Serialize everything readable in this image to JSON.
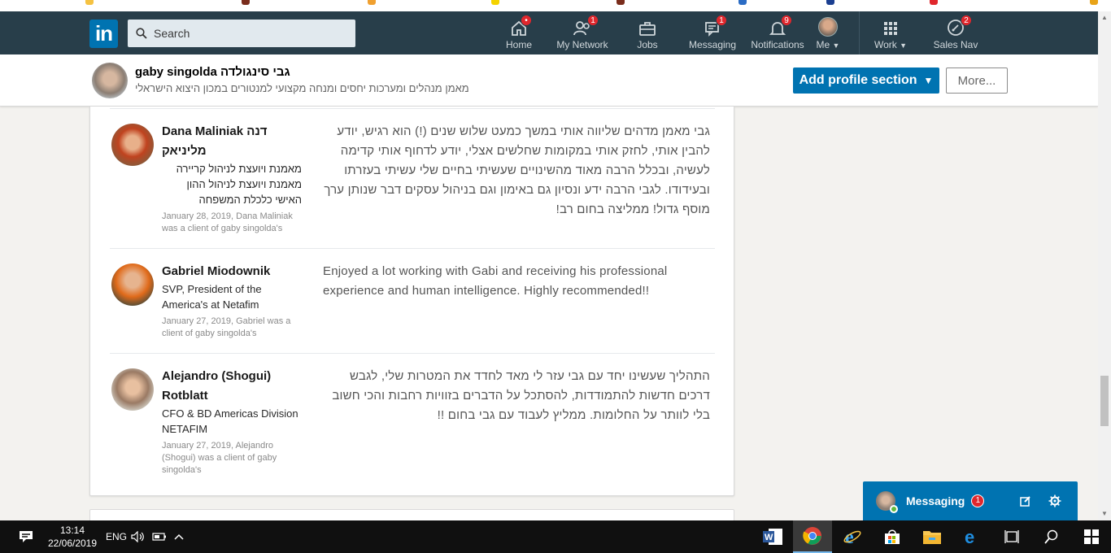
{
  "nav": {
    "search_placeholder": "Search",
    "items": [
      {
        "label": "Home",
        "badge": "•"
      },
      {
        "label": "My Network",
        "badge": "1"
      },
      {
        "label": "Jobs",
        "badge": ""
      },
      {
        "label": "Messaging",
        "badge": "1"
      },
      {
        "label": "Notifications",
        "badge": "9"
      },
      {
        "label": "Me",
        "badge": ""
      },
      {
        "label": "Work",
        "badge": ""
      },
      {
        "label": "Sales Nav",
        "badge": "2"
      }
    ]
  },
  "profile": {
    "name": "gaby singolda גבי סינגולדה",
    "headline": "מאמן מנהלים ומערכות יחסים ומנחה מקצועי למנטורים במכון היצוא הישראלי",
    "add_section_label": "Add profile section",
    "more_label": "More..."
  },
  "recommendations": [
    {
      "name": "Dana Maliniak דנה מליניאק",
      "title": "מאמנת ויועצת לניהול קריירה מאמנת ויועצת לניהול ההון האישי כלכלת המשפחה",
      "meta": "January 28, 2019, Dana Maliniak was a client of gaby singolda's",
      "text": "גבי מאמן מדהים שליווה אותי במשך כמעט שלוש שנים (!) הוא רגיש, יודע להבין אותי, לחזק אותי במקומות שחלשים אצלי, יודע לדחוף אותי קדימה לעשיה, ובכלל הרבה מאוד מהשינויים שעשיתי בחיים שלי עשיתי בעזרתו ובעידודו. לגבי הרבה ידע ונסיון גם באימון וגם בניהול עסקים דבר שנותן ערך מוסף גדול! ממליצה בחום רב!"
    },
    {
      "name": "Gabriel Miodownik",
      "title": "SVP, President of the America's at Netafim",
      "meta": "January 27, 2019, Gabriel was a client of gaby singolda's",
      "text": "Enjoyed a lot working with Gabi and receiving his professional experience and human intelligence. Highly recommended!!"
    },
    {
      "name": "Alejandro (Shogui) Rotblatt",
      "title": "CFO & BD Americas Division NETAFIM",
      "meta": "January 27, 2019, Alejandro (Shogui) was a client of gaby singolda's",
      "text": "התהליך שעשינו יחד עם גבי עזר לי מאד לחדד את המטרות שלי, לגבש דרכים חדשות להתמודדות, להסתכל על הדברים בזוויות רחבות והכי חשוב בלי לוותר על החלומות. ממליץ לעבוד עם גבי בחום !!"
    }
  ],
  "messaging": {
    "label": "Messaging",
    "badge": "1"
  },
  "taskbar": {
    "time": "13:14",
    "date": "22/06/2019",
    "lang": "ENG"
  },
  "colors": {
    "nav_bg": "#283e4a",
    "brand": "#0073b1",
    "badge": "#e0272d"
  }
}
